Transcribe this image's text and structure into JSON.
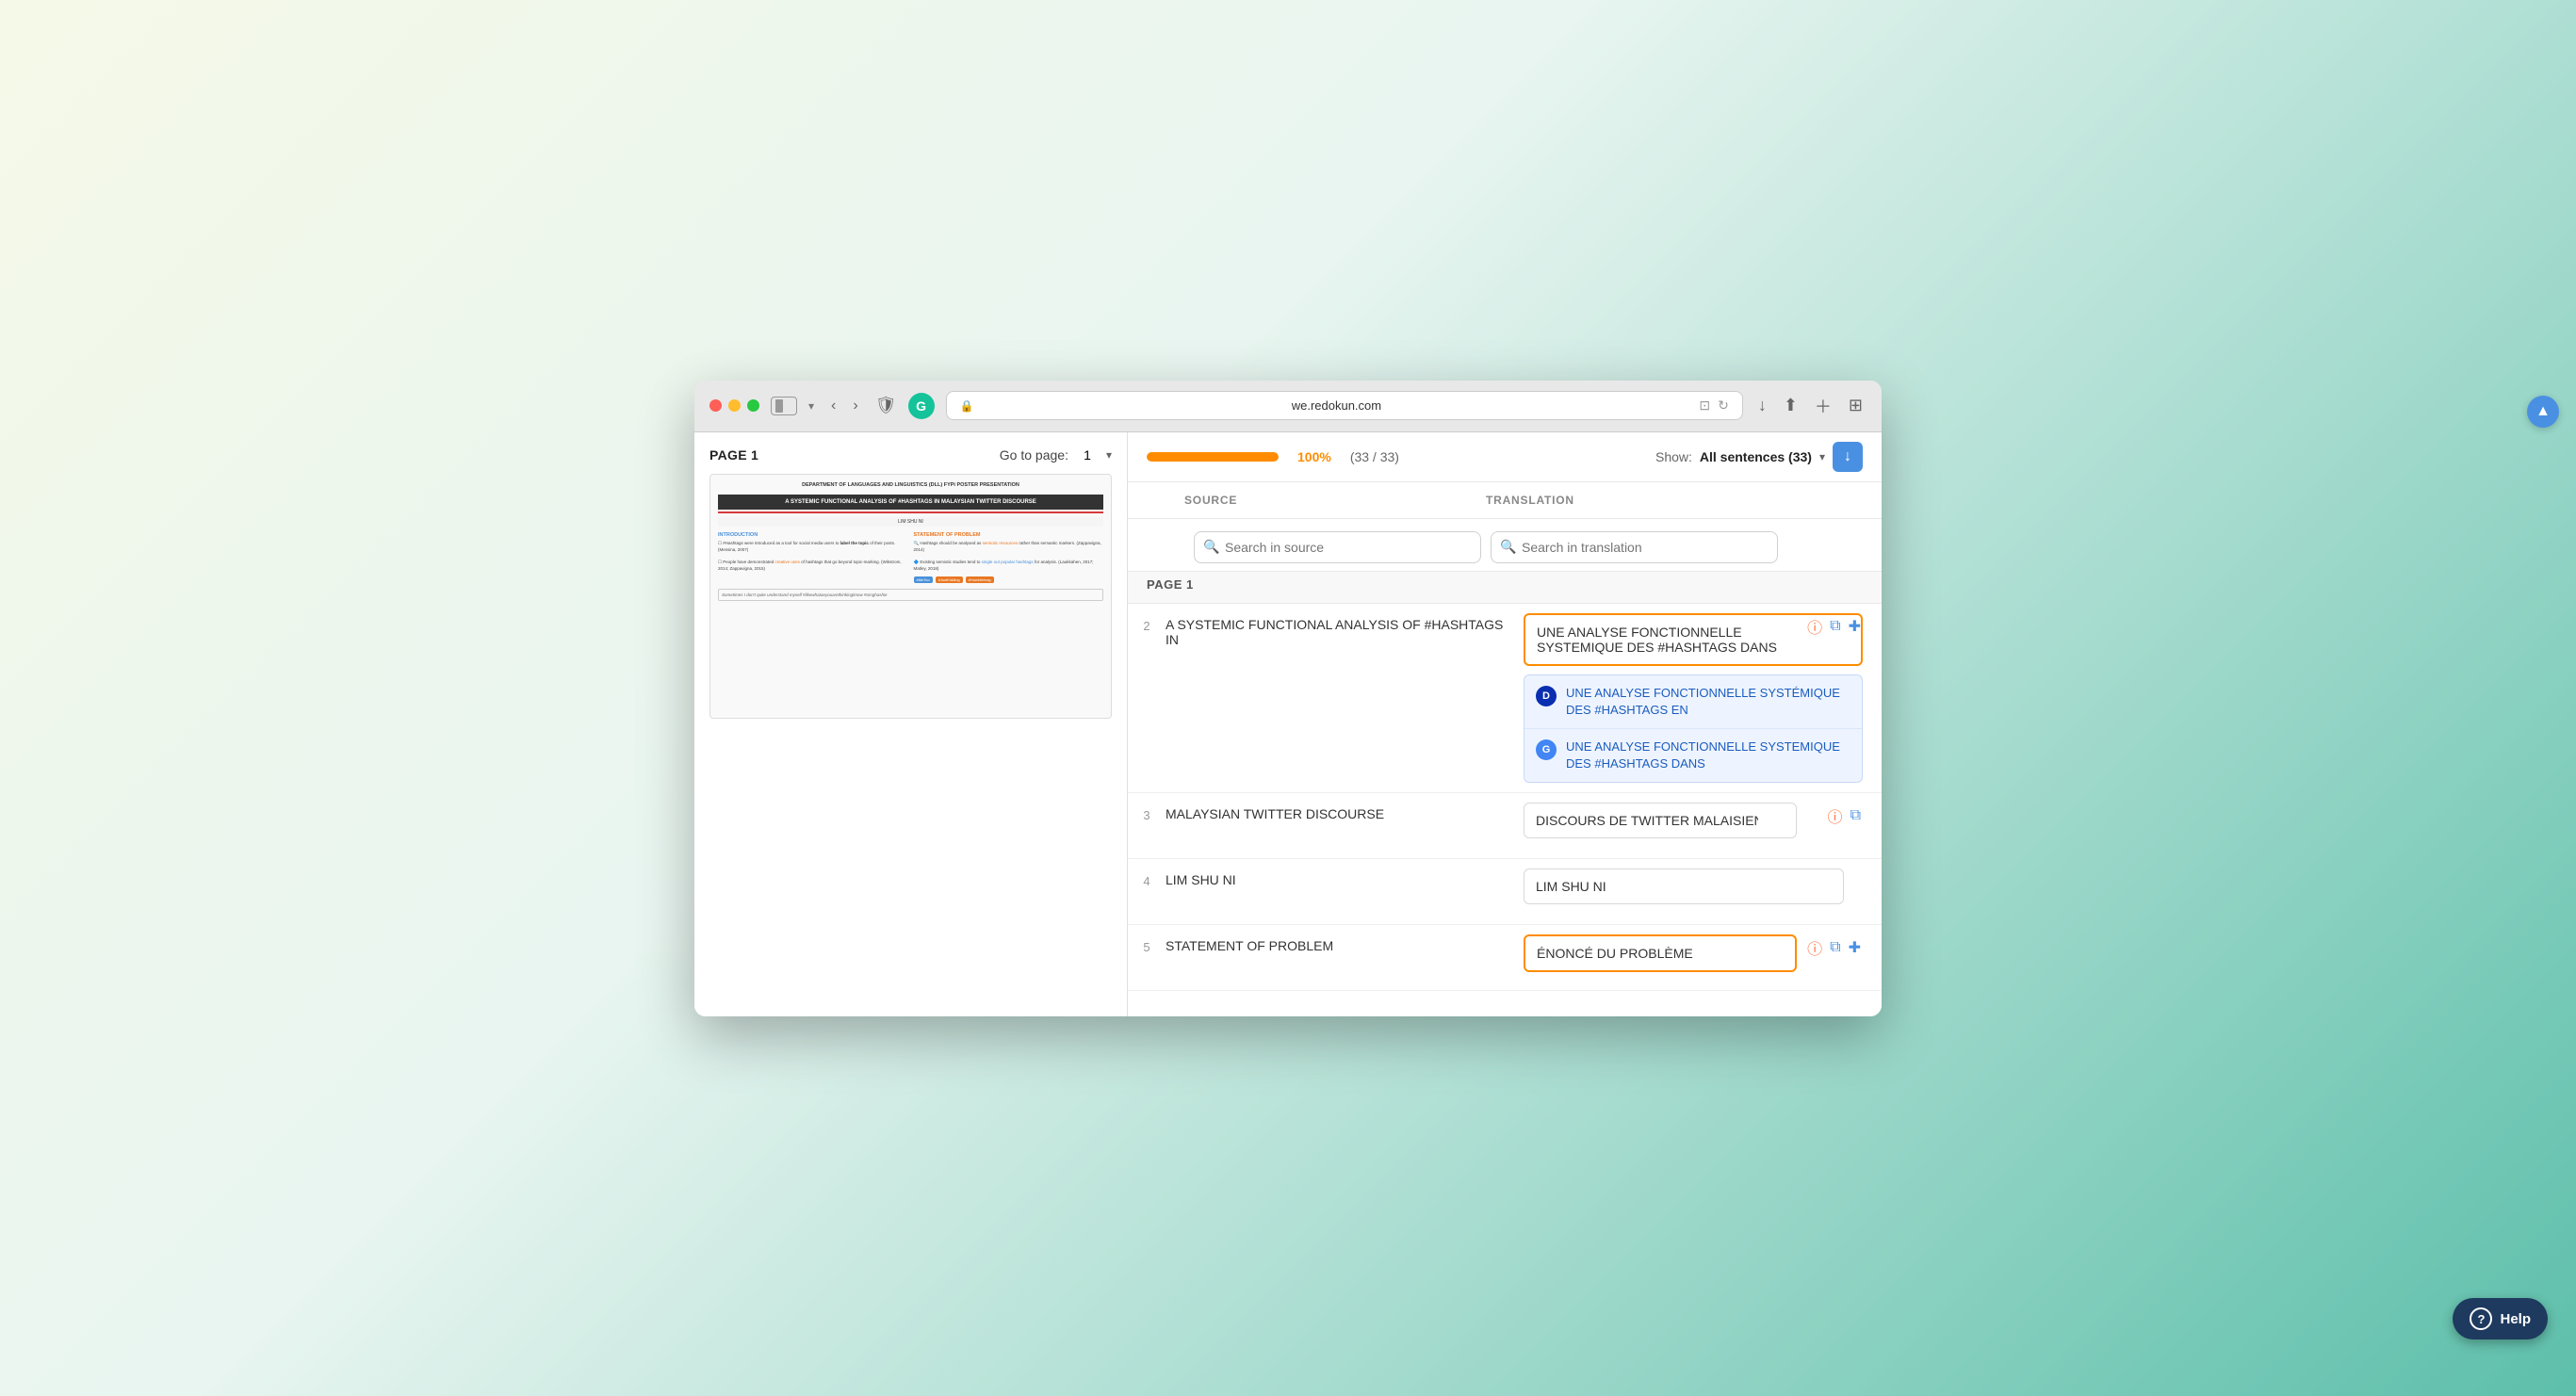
{
  "browser": {
    "url": "we.redokun.com",
    "traffic_lights": [
      "red",
      "yellow",
      "green"
    ]
  },
  "left_panel": {
    "page_label": "PAGE 1",
    "goto_label": "Go to page:",
    "goto_page_value": "1",
    "doc": {
      "header": "DEPARTMENT OF LANGUAGES AND LINGUISTICS (DLL)\nFYPi POSTER PRESENTATION",
      "title": "A SYSTEMIC FUNCTIONAL ANALYSIS OF #HASHTAGS IN MALAYSIAN TWITTER DISCOURSE",
      "author": "LIM SHU NI",
      "intro_title": "INTRODUCTION",
      "intro_items": [
        "#Hashtags were introduced as a tool for social media users to label the topic of their posts. (Messina, 2007)",
        "People have demonstrated creative uses of hashtags that go beyond topic-marking. (Wikstrom, 2014; Zappavigna, 2015)"
      ],
      "problem_title": "STATEMENT OF PROBLEM",
      "problem_items": [
        "Hashtags should be analysed as semiotic resources rather than semantic markers. (Zappavigna, 2014)",
        "Existing semiotic studies tend to single out popular hashtags for analysis. (Laukkahen, 2017; Matley, 2018)"
      ],
      "hashtags": [
        "#MeToo",
        "#JustKidding",
        "#Humblebrag"
      ],
      "bottom_text": "Sometimes I don't quite understand myself #likewhataeyouarethinkingknow #omghashie"
    }
  },
  "top_bar": {
    "progress_percent": "100%",
    "progress_count": "(33 / 33)",
    "show_label": "Show:",
    "show_value": "All sentences (33)"
  },
  "table": {
    "col_source": "SOURCE",
    "col_translation": "TRANSLATION",
    "search_source_placeholder": "Search in source",
    "search_translation_placeholder": "Search in translation",
    "page_section": "PAGE 1",
    "rows": [
      {
        "num": "2",
        "source": "A SYSTEMIC FUNCTIONAL ANALYSIS OF #HASHTAGS IN",
        "translation": "UNE ANALYSE FONCTIONNELLE SYSTEMIQUE DES #HASHTAGS DANS",
        "has_warning": true,
        "has_copy": true,
        "has_check": true,
        "active": true,
        "suggestions": [
          {
            "type": "deepl",
            "icon_label": "D",
            "text": "UNE ANALYSE FONCTIONNELLE SYSTÉMIQUE DES #HASHTAGS EN"
          },
          {
            "type": "google",
            "icon_label": "G",
            "text": "UNE ANALYSE FONCTIONNELLE SYSTEMIQUE DES #HASHTAGS DANS"
          }
        ]
      },
      {
        "num": "3",
        "source": "MALAYSIAN TWITTER DISCOURSE",
        "translation": "DISCOURS DE TWITTER MALAISIEN",
        "has_warning": true,
        "has_copy": true,
        "has_check": false,
        "active": false,
        "suggestions": []
      },
      {
        "num": "4",
        "source": "LIM SHU NI",
        "translation": "LIM SHU NI",
        "has_warning": false,
        "has_copy": false,
        "has_check": false,
        "active": false,
        "suggestions": []
      },
      {
        "num": "5",
        "source": "STATEMENT OF PROBLEM",
        "translation": "ÉNONCÉ DU PROBLÈME",
        "has_warning": true,
        "has_copy": true,
        "has_check": true,
        "active": false,
        "suggestions": []
      }
    ]
  },
  "help": {
    "label": "Help"
  },
  "icons": {
    "search": "🔍",
    "chevron_down": "▾",
    "warning": "ⓘ",
    "copy": "⧉",
    "check": "✚",
    "download": "↓",
    "shield": "🛡",
    "back": "‹",
    "forward": "›",
    "reload": "↻",
    "scroll_up": "▲"
  }
}
